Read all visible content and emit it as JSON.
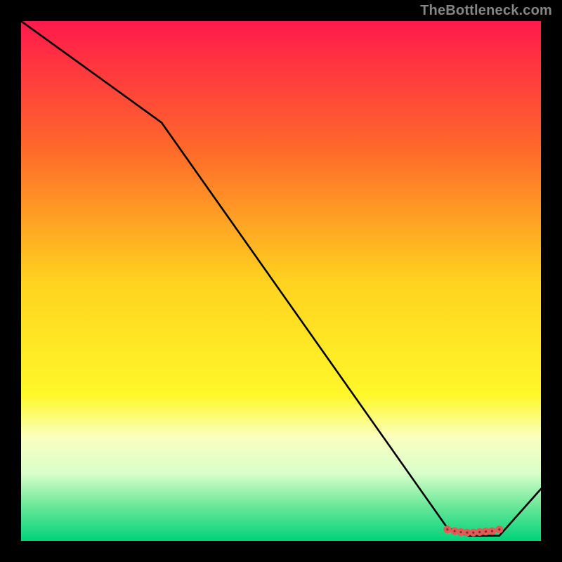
{
  "attribution": "TheBottleneck.com",
  "chart_data": {
    "type": "line",
    "title": "",
    "xlabel": "",
    "ylabel": "",
    "xlim": [
      0,
      100
    ],
    "ylim": [
      0,
      100
    ],
    "gradient_stops": [
      {
        "offset": 0,
        "color": "#ff1a4b"
      },
      {
        "offset": 25,
        "color": "#ff6a2a"
      },
      {
        "offset": 50,
        "color": "#ffd21f"
      },
      {
        "offset": 72,
        "color": "#fff82a"
      },
      {
        "offset": 80,
        "color": "#fbffbf"
      },
      {
        "offset": 87,
        "color": "#d8ffca"
      },
      {
        "offset": 93,
        "color": "#6fe89a"
      },
      {
        "offset": 100,
        "color": "#00d37a"
      }
    ],
    "curve": [
      {
        "x": 0,
        "y": 100
      },
      {
        "x": 27,
        "y": 80.5
      },
      {
        "x": 82,
        "y": 2.5
      },
      {
        "x": 86,
        "y": 1.0
      },
      {
        "x": 92,
        "y": 1.0
      },
      {
        "x": 100,
        "y": 10
      }
    ],
    "markers": [
      {
        "x": 82.0,
        "y": 2.2
      },
      {
        "x": 83.4,
        "y": 1.9
      },
      {
        "x": 84.6,
        "y": 1.7
      },
      {
        "x": 85.8,
        "y": 1.6
      },
      {
        "x": 87.0,
        "y": 1.6
      },
      {
        "x": 88.2,
        "y": 1.7
      },
      {
        "x": 89.4,
        "y": 1.8
      },
      {
        "x": 90.6,
        "y": 1.9
      },
      {
        "x": 92.0,
        "y": 2.2
      }
    ],
    "marker_style": {
      "r_outer": 5.5,
      "fill": "#e55a57",
      "hole": 1.6
    }
  }
}
